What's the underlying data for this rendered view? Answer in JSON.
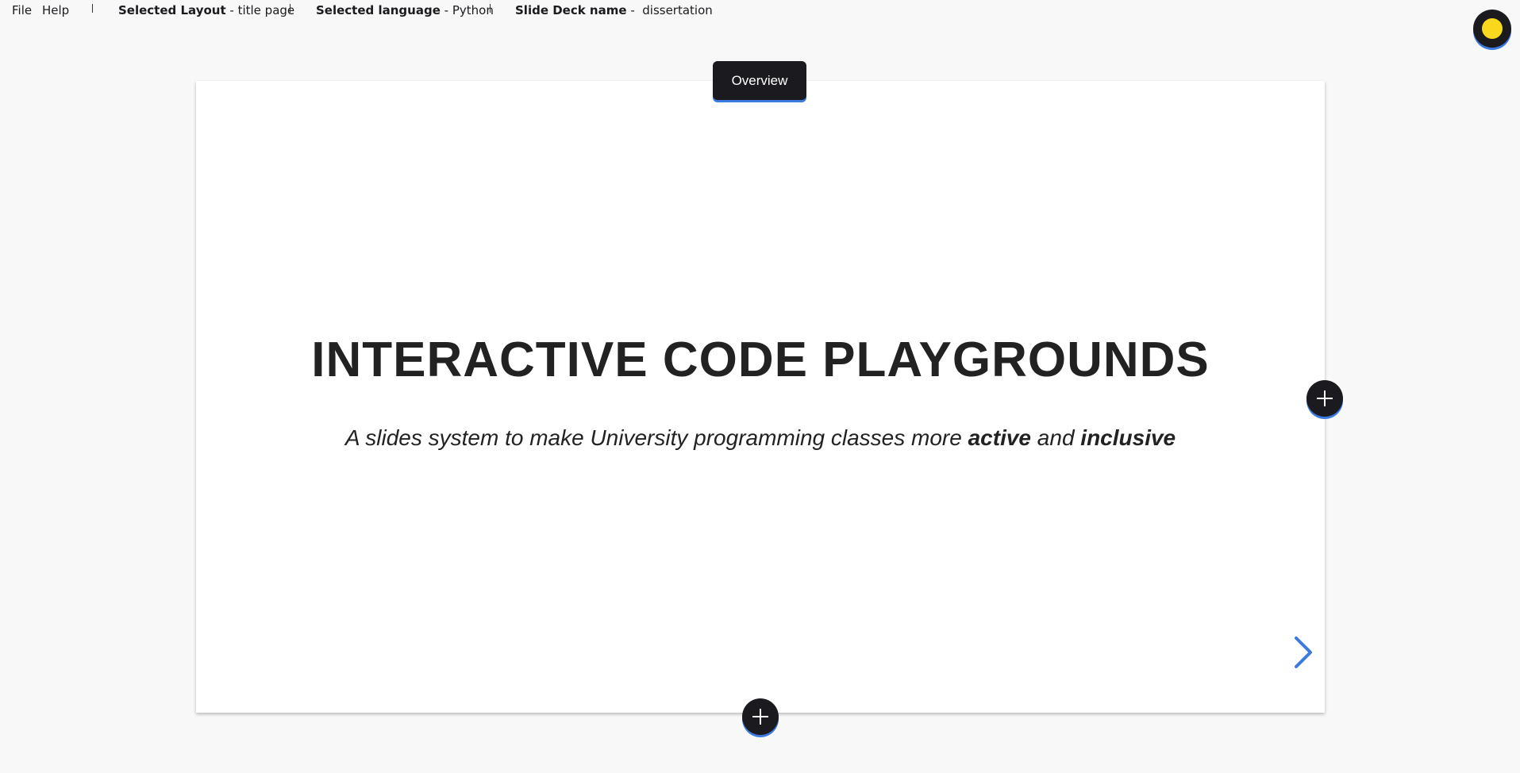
{
  "menu": {
    "file": "File",
    "help": "Help",
    "separator": "|"
  },
  "status": {
    "layout_label": "Selected Layout",
    "layout_value": " - title page",
    "language_label": "Selected language",
    "language_value": " - Python",
    "deck_label": "Slide Deck name",
    "deck_value": " -  dissertation"
  },
  "slide": {
    "overview_label": "Overview",
    "title": "INTERACTIVE CODE PLAYGROUNDS",
    "subtitle_part1": "A slides system to make University programming classes more ",
    "subtitle_bold1": "active",
    "subtitle_part2": " and ",
    "subtitle_bold2": "inclusive"
  },
  "icons": {
    "theme_toggle": "sun-icon",
    "add_slide_right": "plus-icon",
    "add_slide_below": "plus-icon",
    "next_slide": "chevron-right-icon"
  },
  "colors": {
    "background": "#f8f8f8",
    "slide": "#ffffff",
    "button_dark": "#1b1b1f",
    "accent_blue": "#3b7be0",
    "sun_yellow": "#f9d71c",
    "text": "#222222"
  }
}
